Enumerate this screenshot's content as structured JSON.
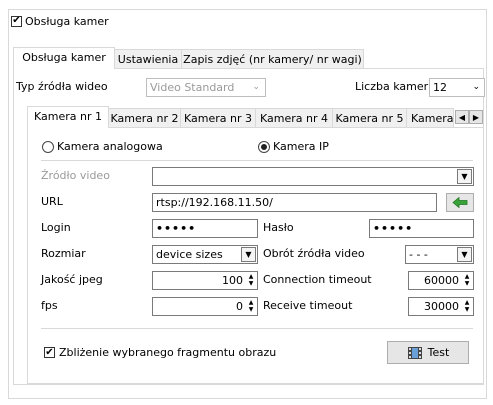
{
  "main_checkbox": {
    "label": "Obsługa kamer",
    "checked": true
  },
  "top_tabs": [
    {
      "label": "Obsługa kamer",
      "active": true
    },
    {
      "label": "Ustawienia",
      "active": false
    },
    {
      "label": "Zapis zdjęć (nr kamery/ nr wagi)",
      "active": false
    }
  ],
  "source_type": {
    "label": "Typ źródła wideo",
    "value": "Video Standard"
  },
  "camera_count": {
    "label": "Liczba kamer",
    "value": "12"
  },
  "camera_tabs": [
    "Kamera nr 1",
    "Kamera nr 2",
    "Kamera nr 3",
    "Kamera nr 4",
    "Kamera nr 5",
    "Kamera"
  ],
  "camera_type": {
    "analog_label": "Kamera analogowa",
    "ip_label": "Kamera IP",
    "selected": "ip"
  },
  "form": {
    "video_source": {
      "label": "Źródło video",
      "value": ""
    },
    "url": {
      "label": "URL",
      "value": "rtsp://192.168.11.50/"
    },
    "login": {
      "label": "Login",
      "value": "•••••"
    },
    "password": {
      "label": "Hasło",
      "value": "•••••"
    },
    "size": {
      "label": "Rozmiar",
      "value": "device sizes"
    },
    "rotation": {
      "label": "Obrót źródła video",
      "value": "- - -"
    },
    "jpeg_quality": {
      "label": "Jakość jpeg",
      "value": "100"
    },
    "connection_timeout": {
      "label": "Connection timeout",
      "value": "60000"
    },
    "fps": {
      "label": "fps",
      "value": "0"
    },
    "receive_timeout": {
      "label": "Receive timeout",
      "value": "30000"
    }
  },
  "zoom_checkbox": {
    "label": "Zbliżenie wybranego fragmentu obrazu",
    "checked": true
  },
  "test_button": {
    "label": "Test"
  },
  "colors": {
    "arrow_green": "#3aa23a",
    "border": "#d9d9d9"
  }
}
